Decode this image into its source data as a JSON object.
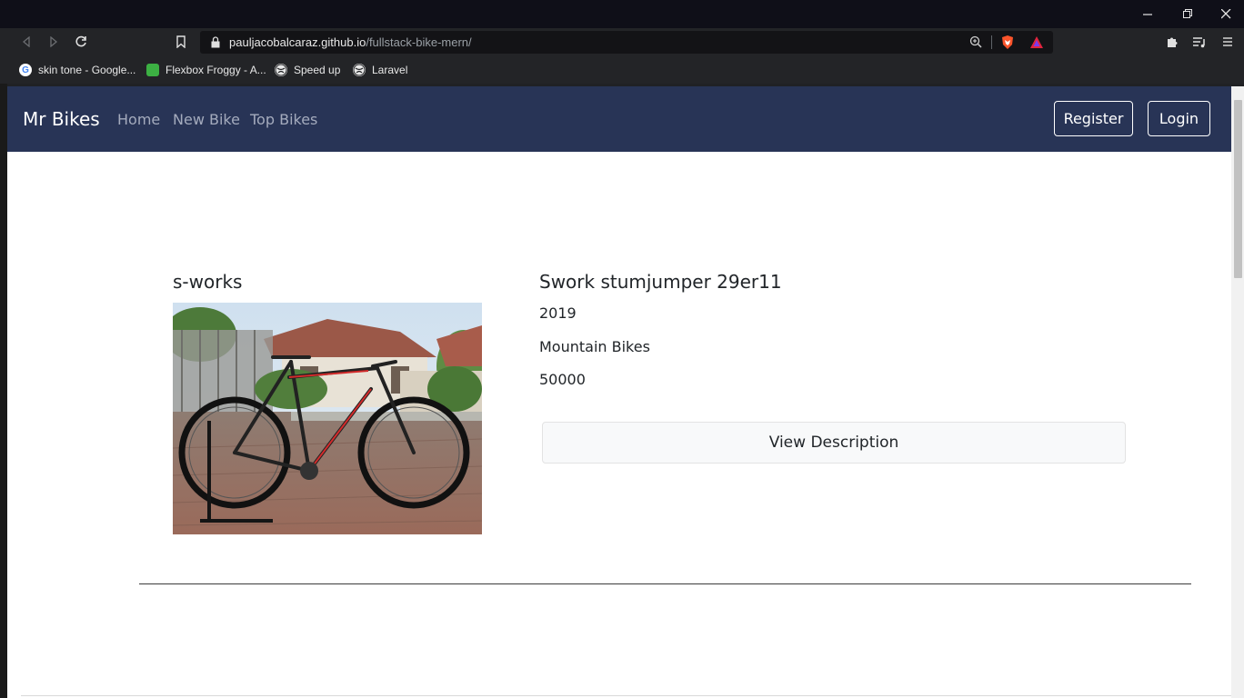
{
  "browser": {
    "url_host": "pauljacobalcaraz.github.io",
    "url_path": "/fullstack-bike-mern/",
    "bookmarks": [
      {
        "label": "skin tone - Google...",
        "icon": "google-icon"
      },
      {
        "label": "Flexbox Froggy - A...",
        "icon": "frog-icon"
      },
      {
        "label": "Speed up",
        "icon": "globe-icon"
      },
      {
        "label": "Laravel",
        "icon": "globe-icon"
      }
    ]
  },
  "navbar": {
    "brand": "Mr Bikes",
    "links": [
      "Home",
      "New Bike",
      "Top Bikes"
    ],
    "register": "Register",
    "login": "Login",
    "bg_color": "#283456"
  },
  "bike": {
    "brand": "s-works",
    "model": "Swork stumjumper 29er11",
    "year": "2019",
    "category": "Mountain Bikes",
    "price": "50000",
    "view_button": "View Description"
  }
}
